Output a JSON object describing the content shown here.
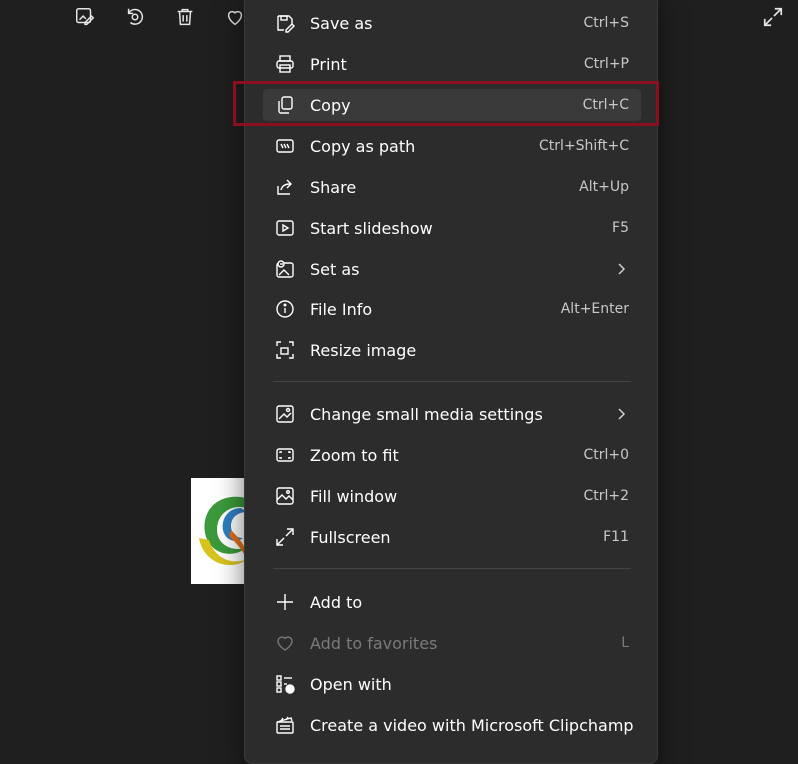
{
  "toolbar": {
    "icons": [
      "edit-image-icon",
      "rotate-icon",
      "delete-icon",
      "favorite-heart-icon"
    ],
    "fullscreen_icon": "expand-icon"
  },
  "menu": {
    "items": [
      {
        "label": "Save as",
        "shortcut": "Ctrl+S",
        "icon": "save-as-icon"
      },
      {
        "label": "Print",
        "shortcut": "Ctrl+P",
        "icon": "printer-icon"
      },
      {
        "label": "Copy",
        "shortcut": "Ctrl+C",
        "icon": "copy-icon"
      },
      {
        "label": "Copy as path",
        "shortcut": "Ctrl+Shift+C",
        "icon": "copy-path-icon"
      },
      {
        "label": "Share",
        "shortcut": "Alt+Up",
        "icon": "share-icon"
      },
      {
        "label": "Start slideshow",
        "shortcut": "F5",
        "icon": "slideshow-icon"
      },
      {
        "label": "Set as",
        "shortcut": "",
        "icon": "set-as-icon"
      },
      {
        "label": "File Info",
        "shortcut": "Alt+Enter",
        "icon": "info-icon"
      },
      {
        "label": "Resize image",
        "shortcut": "",
        "icon": "resize-icon"
      },
      {
        "label": "Change small media settings",
        "shortcut": "",
        "icon": "image-settings-icon"
      },
      {
        "label": "Zoom to fit",
        "shortcut": "Ctrl+0",
        "icon": "zoom-fit-icon"
      },
      {
        "label": "Fill window",
        "shortcut": "Ctrl+2",
        "icon": "fill-window-icon"
      },
      {
        "label": "Fullscreen",
        "shortcut": "F11",
        "icon": "fullscreen-icon"
      },
      {
        "label": "Add to",
        "shortcut": "",
        "icon": "plus-icon"
      },
      {
        "label": "Add to favorites",
        "shortcut": "L",
        "icon": "heart-icon"
      },
      {
        "label": "Open with",
        "shortcut": "",
        "icon": "open-with-icon"
      },
      {
        "label": "Create a video with Microsoft Clipchamp",
        "shortcut": "",
        "icon": "clipchamp-icon"
      }
    ]
  },
  "colors": {
    "background": "#1f1f1f",
    "menu_background": "#2c2c2c",
    "hover_background": "#3a3a3a",
    "highlight_border": "#8b0f1e",
    "disabled_text": "#7a7a7a"
  }
}
